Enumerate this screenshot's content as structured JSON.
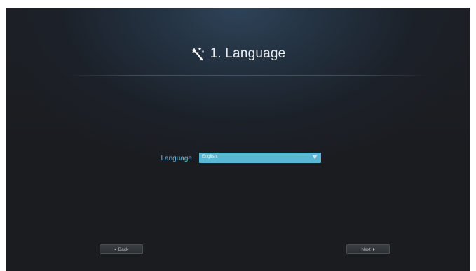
{
  "wizard": {
    "title": "1. Language",
    "icon": "magic-wand-icon"
  },
  "form": {
    "language_label": "Language",
    "language_select": {
      "selected": "English"
    }
  },
  "nav": {
    "back_label": "Back",
    "next_label": "Next"
  },
  "colors": {
    "accent": "#5ab7d3",
    "label": "#6fb8d8",
    "title": "#e9edf1",
    "background": "#1b1d21"
  }
}
